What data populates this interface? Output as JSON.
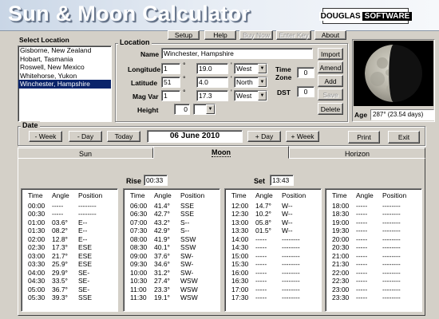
{
  "app": {
    "title": "Sun & Moon Calculator",
    "logo_part1": "DOUGLAS",
    "logo_part2": "SOFTWARE"
  },
  "toolbar": {
    "setup": "Setup",
    "help": "Help",
    "buy_now": "Buy Now",
    "enter_key": "Enter Key",
    "about": "About"
  },
  "select_location": {
    "label": "Select Location",
    "items": [
      "Gisborne, New Zealand",
      "Hobart, Tasmania",
      "Roswell, New Mexico",
      "Whitehorse, Yukon",
      "Winchester, Hampshire"
    ],
    "selected_index": 4
  },
  "location": {
    "label": "Location",
    "name_label": "Name",
    "name_value": "Winchester, Hampshire",
    "longitude_label": "Longitude",
    "longitude_deg": "1",
    "longitude_min": "19.0",
    "longitude_dir": "West",
    "latitude_label": "Latitude",
    "latitude_deg": "51",
    "latitude_min": "4.0",
    "latitude_dir": "North",
    "magvar_label": "Mag Var",
    "magvar_deg": "1",
    "magvar_min": "17.3",
    "magvar_dir": "West",
    "height_label": "Height",
    "height_value": "0",
    "timezone_label1": "Time",
    "timezone_label2": "Zone",
    "timezone_value": "0",
    "dst_label": "DST",
    "dst_value": "0",
    "degree_symbol": "°",
    "minute_symbol": "'"
  },
  "location_buttons": {
    "import": "Import",
    "amend": "Amend",
    "add": "Add",
    "save": "Save",
    "delete": "Delete"
  },
  "moon_info": {
    "age_label": "Age",
    "age_value": "287° (23.54 days)",
    "illuminated_fraction": 0.42
  },
  "date": {
    "label": "Date",
    "minus_week": "- Week",
    "minus_day": "- Day",
    "today": "Today",
    "current": "06 June 2010",
    "plus_day": "+ Day",
    "plus_week": "+ Week",
    "print": "Print",
    "exit": "Exit"
  },
  "tabs": [
    {
      "label": "Sun"
    },
    {
      "label": "Moon"
    },
    {
      "label": "Horizon"
    }
  ],
  "active_tab": 1,
  "moon": {
    "rise_label": "Rise",
    "rise_value": "00:33",
    "set_label": "Set",
    "set_value": "13:43",
    "columns": {
      "time": "Time",
      "angle": "Angle",
      "position": "Position"
    },
    "tables": [
      [
        [
          "00:00",
          "-----",
          "--------"
        ],
        [
          "00:30",
          "-----",
          "--------"
        ],
        [
          "01:00",
          "03.6°",
          "E--"
        ],
        [
          "01:30",
          "08.2°",
          "E--"
        ],
        [
          "02:00",
          "12.8°",
          "E--"
        ],
        [
          "02:30",
          "17.3°",
          "ESE"
        ],
        [
          "03:00",
          "21.7°",
          "ESE"
        ],
        [
          "03:30",
          "25.9°",
          "ESE"
        ],
        [
          "04:00",
          "29.9°",
          "SE-"
        ],
        [
          "04:30",
          "33.5°",
          "SE-"
        ],
        [
          "05:00",
          "36.7°",
          "SE-"
        ],
        [
          "05:30",
          "39.3°",
          "SSE"
        ]
      ],
      [
        [
          "06:00",
          "41.4°",
          "SSE"
        ],
        [
          "06:30",
          "42.7°",
          "SSE"
        ],
        [
          "07:00",
          "43.2°",
          "S--"
        ],
        [
          "07:30",
          "42.9°",
          "S--"
        ],
        [
          "08:00",
          "41.9°",
          "SSW"
        ],
        [
          "08:30",
          "40.1°",
          "SSW"
        ],
        [
          "09:00",
          "37.6°",
          "SW-"
        ],
        [
          "09:30",
          "34.6°",
          "SW-"
        ],
        [
          "10:00",
          "31.2°",
          "SW-"
        ],
        [
          "10:30",
          "27.4°",
          "WSW"
        ],
        [
          "11:00",
          "23.3°",
          "WSW"
        ],
        [
          "11:30",
          "19.1°",
          "WSW"
        ]
      ],
      [
        [
          "12:00",
          "14.7°",
          "W--"
        ],
        [
          "12:30",
          "10.2°",
          "W--"
        ],
        [
          "13:00",
          "05.8°",
          "W--"
        ],
        [
          "13:30",
          "01.5°",
          "W--"
        ],
        [
          "14:00",
          "-----",
          "--------"
        ],
        [
          "14:30",
          "-----",
          "--------"
        ],
        [
          "15:00",
          "-----",
          "--------"
        ],
        [
          "15:30",
          "-----",
          "--------"
        ],
        [
          "16:00",
          "-----",
          "--------"
        ],
        [
          "16:30",
          "-----",
          "--------"
        ],
        [
          "17:00",
          "-----",
          "--------"
        ],
        [
          "17:30",
          "-----",
          "--------"
        ]
      ],
      [
        [
          "18:00",
          "-----",
          "--------"
        ],
        [
          "18:30",
          "-----",
          "--------"
        ],
        [
          "19:00",
          "-----",
          "--------"
        ],
        [
          "19:30",
          "-----",
          "--------"
        ],
        [
          "20:00",
          "-----",
          "--------"
        ],
        [
          "20:30",
          "-----",
          "--------"
        ],
        [
          "21:00",
          "-----",
          "--------"
        ],
        [
          "21:30",
          "-----",
          "--------"
        ],
        [
          "22:00",
          "-----",
          "--------"
        ],
        [
          "22:30",
          "-----",
          "--------"
        ],
        [
          "23:00",
          "-----",
          "--------"
        ],
        [
          "23:30",
          "-----",
          "--------"
        ]
      ]
    ]
  },
  "colors": {
    "selection": "#0a246a",
    "panel": "#d4d0c8",
    "header_start": "#c9d6e6"
  }
}
